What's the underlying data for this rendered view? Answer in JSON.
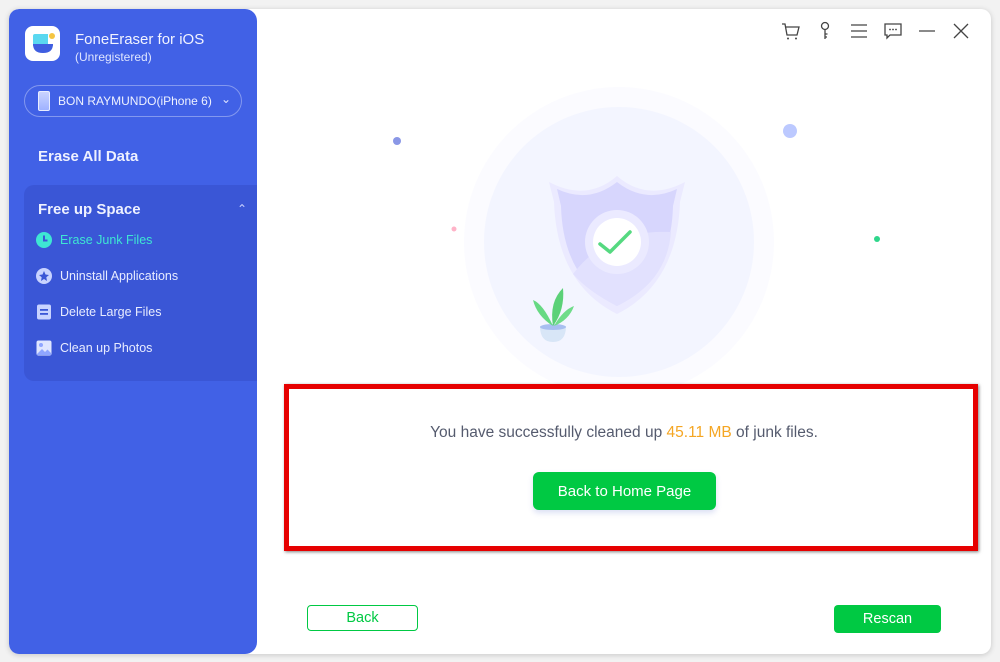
{
  "app": {
    "title": "FoneEraser for iOS",
    "subtitle": "(Unregistered)"
  },
  "device": {
    "selected": "BON RAYMUNDO(iPhone 6)"
  },
  "sidebar": {
    "erase_all": "Erase All Data",
    "group_title": "Free up Space",
    "items": [
      {
        "label": "Erase Junk Files",
        "icon": "clock-icon",
        "active": true
      },
      {
        "label": "Uninstall Applications",
        "icon": "app-store-icon",
        "active": false
      },
      {
        "label": "Delete Large Files",
        "icon": "file-icon",
        "active": false
      },
      {
        "label": "Clean up Photos",
        "icon": "photo-icon",
        "active": false
      }
    ]
  },
  "titlebar": {
    "icons": [
      "cart-icon",
      "key-icon",
      "menu-icon",
      "feedback-icon",
      "minimize-icon",
      "close-icon"
    ]
  },
  "result": {
    "prefix": "You have successfully cleaned up ",
    "amount": "45.11 MB",
    "suffix": " of junk files.",
    "home_button": "Back to Home Page"
  },
  "footer": {
    "back": "Back",
    "rescan": "Rescan"
  },
  "colors": {
    "sidebar": "#4161e6",
    "accent_green": "#00c943",
    "amount": "#f5a623",
    "highlight": "#e60000",
    "active_item": "#3ee6d3"
  }
}
